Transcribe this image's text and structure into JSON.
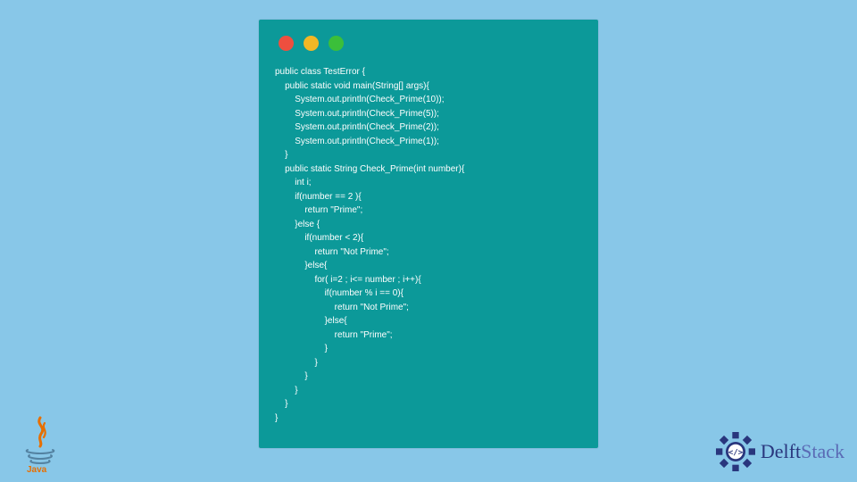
{
  "code_lines": [
    "public class TestError {",
    "    public static void main(String[] args){",
    "        System.out.println(Check_Prime(10));",
    "        System.out.println(Check_Prime(5));",
    "        System.out.println(Check_Prime(2));",
    "        System.out.println(Check_Prime(1));",
    "    }",
    "    public static String Check_Prime(int number){",
    "        int i;",
    "        if(number == 2 ){",
    "            return \"Prime\";",
    "        }else {",
    "            if(number < 2){",
    "                return \"Not Prime\";",
    "            }else{",
    "                for( i=2 ; i<= number ; i++){",
    "                    if(number % i == 0){",
    "                        return \"Not Prime\";",
    "                    }else{",
    "                        return \"Prime\";",
    "                    }",
    "                }",
    "            }",
    "        }",
    "    }",
    "}"
  ],
  "branding": {
    "java_label": "Java",
    "delft_main": "Delft",
    "delft_sub": "Stack"
  },
  "colors": {
    "page_bg": "#88c7e8",
    "window_bg": "#0c9999",
    "dot_red": "#ee4f3f",
    "dot_yellow": "#f2b725",
    "dot_green": "#3bbf3a",
    "code_text": "#ffffff",
    "delft_primary": "#29367d"
  }
}
